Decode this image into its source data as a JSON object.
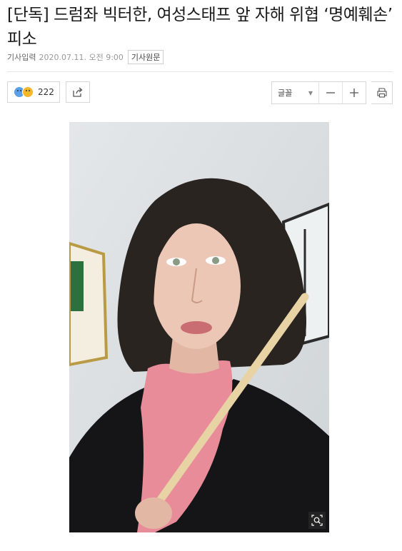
{
  "article": {
    "headline": "[단독] 드럼좌 빅터한, 여성스태프 앞 자해 위협 ‘명예훼손’ 피소",
    "input_label": "기사입력",
    "date": "2020.07.11. 오전 9:00",
    "original_label": "기사원문"
  },
  "toolbar": {
    "reaction_count": "222",
    "font_label": "글꼴",
    "minus": "—",
    "plus": "+"
  },
  "icons": {
    "reaction": "reaction-emoji-icon",
    "share": "share-icon",
    "print": "print-icon",
    "zoom": "zoom-icon"
  },
  "colors": {
    "headline": "#1a1a1a",
    "border": "#d7d7d7",
    "date": "#999999"
  }
}
